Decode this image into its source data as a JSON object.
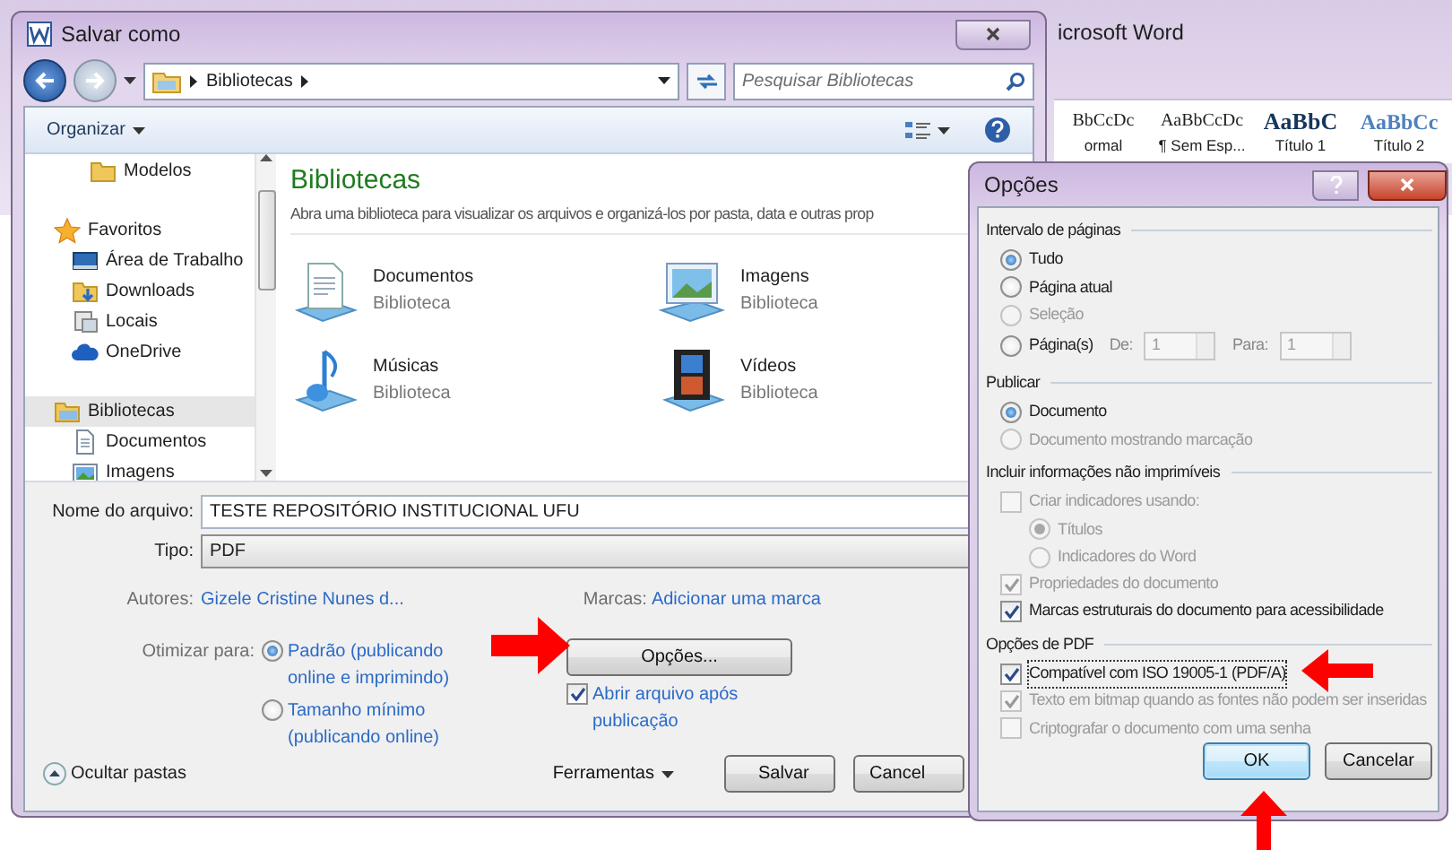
{
  "background_window": {
    "title": "icrosoft Word",
    "styles": [
      {
        "sample": "BbCcDc",
        "label": "ormal",
        "kind": "plain"
      },
      {
        "sample": "AaBbCcDc",
        "label": "¶ Sem Esp...",
        "kind": "plain"
      },
      {
        "sample": "AaBbC",
        "label": "Título 1",
        "kind": "heading"
      },
      {
        "sample": "AaBbCc",
        "label": "Título 2",
        "kind": "subheading"
      }
    ]
  },
  "save_dialog": {
    "title": "Salvar como",
    "breadcrumb": "Bibliotecas",
    "search": {
      "placeholder": "Pesquisar Bibliotecas"
    },
    "organize": "Organizar",
    "sidebar": {
      "items": [
        {
          "label": "Modelos",
          "kind": "folder",
          "selected": false
        },
        {
          "label": "Favoritos",
          "kind": "star",
          "selected": false,
          "children": [
            {
              "label": "Área de Trabalho",
              "kind": "desktop",
              "selected": false
            },
            {
              "label": "Downloads",
              "kind": "downloads",
              "selected": false
            },
            {
              "label": "Locais",
              "kind": "places",
              "selected": false
            },
            {
              "label": "OneDrive",
              "kind": "cloud",
              "selected": false
            }
          ]
        },
        {
          "label": "Bibliotecas",
          "kind": "library",
          "selected": true,
          "children": [
            {
              "label": "Documentos",
              "kind": "document",
              "selected": false
            },
            {
              "label": "Imagens",
              "kind": "image",
              "selected": false
            }
          ]
        }
      ]
    },
    "content": {
      "heading": "Bibliotecas",
      "description": "Abra uma biblioteca para visualizar os arquivos e organizá-los por pasta, data e outras prop",
      "libraries": [
        {
          "name": "Documentos",
          "type": "Biblioteca",
          "kind": "documents"
        },
        {
          "name": "Imagens",
          "type": "Biblioteca",
          "kind": "pictures"
        },
        {
          "name": "Músicas",
          "type": "Biblioteca",
          "kind": "music"
        },
        {
          "name": "Vídeos",
          "type": "Biblioteca",
          "kind": "videos"
        }
      ]
    },
    "form": {
      "filename_label": "Nome do arquivo:",
      "filename": "TESTE REPOSITÓRIO INSTITUCIONAL UFU",
      "type_label": "Tipo:",
      "type": "PDF",
      "authors_label": "Autores:",
      "authors": "Gizele Cristine Nunes d...",
      "tags_label": "Marcas:",
      "tags": "Adicionar uma marca",
      "optimize_label": "Otimizar para:",
      "optimize_options": [
        {
          "label": "Padrão (publicando online e imprimindo)",
          "selected": true
        },
        {
          "label": "Tamanho mínimo (publicando online)",
          "selected": false
        }
      ],
      "options_button": "Opções...",
      "open_after": {
        "label": "Abrir arquivo após publicação",
        "checked": true
      }
    },
    "footer": {
      "hide_folders": "Ocultar pastas",
      "tools": "Ferramentas",
      "buttons": [
        "Salvar",
        "Cancel"
      ]
    }
  },
  "options_dialog": {
    "title": "Opções",
    "sections": [
      {
        "title": "Intervalo de páginas",
        "items": [
          {
            "kind": "radio",
            "label": "Tudo",
            "selected": true,
            "disabled": false
          },
          {
            "kind": "radio",
            "label": "Página atual",
            "selected": false,
            "disabled": false
          },
          {
            "kind": "radio",
            "label": "Seleção",
            "selected": false,
            "disabled": true
          },
          {
            "kind": "range",
            "label": "Página(s)",
            "selected": false,
            "disabled": false,
            "from_label": "De:",
            "from": "1",
            "to_label": "Para:",
            "to": "1"
          }
        ]
      },
      {
        "title": "Publicar",
        "items": [
          {
            "kind": "radio",
            "label": "Documento",
            "selected": true,
            "disabled": false
          },
          {
            "kind": "radio",
            "label": "Documento mostrando marcação",
            "selected": false,
            "disabled": true
          }
        ]
      },
      {
        "title": "Incluir informações não imprimíveis",
        "items": [
          {
            "kind": "checkbox",
            "label": "Criar indicadores usando:",
            "checked": false,
            "disabled": true,
            "children": [
              {
                "kind": "radio",
                "label": "Títulos",
                "selected": true,
                "disabled": true
              },
              {
                "kind": "radio",
                "label": "Indicadores do Word",
                "selected": false,
                "disabled": true
              }
            ]
          },
          {
            "kind": "checkbox",
            "label": "Propriedades do documento",
            "checked": true,
            "disabled": true
          },
          {
            "kind": "checkbox",
            "label": "Marcas estruturais do documento para acessibilidade",
            "checked": true,
            "disabled": false
          }
        ]
      },
      {
        "title": "Opções de PDF",
        "items": [
          {
            "kind": "checkbox",
            "label": "Compatível com ISO 19005-1 (PDF/A)",
            "checked": true,
            "disabled": false,
            "focused": true
          },
          {
            "kind": "checkbox",
            "label": "Texto em bitmap quando as fontes não podem ser inseridas",
            "checked": true,
            "disabled": true
          },
          {
            "kind": "checkbox",
            "label": "Criptografar o documento com uma senha",
            "checked": false,
            "disabled": true
          }
        ]
      }
    ],
    "buttons": [
      {
        "label": "OK",
        "default": true
      },
      {
        "label": "Cancelar",
        "default": false
      }
    ]
  },
  "annotations": [
    {
      "kind": "right"
    },
    {
      "kind": "left"
    },
    {
      "kind": "up"
    }
  ]
}
